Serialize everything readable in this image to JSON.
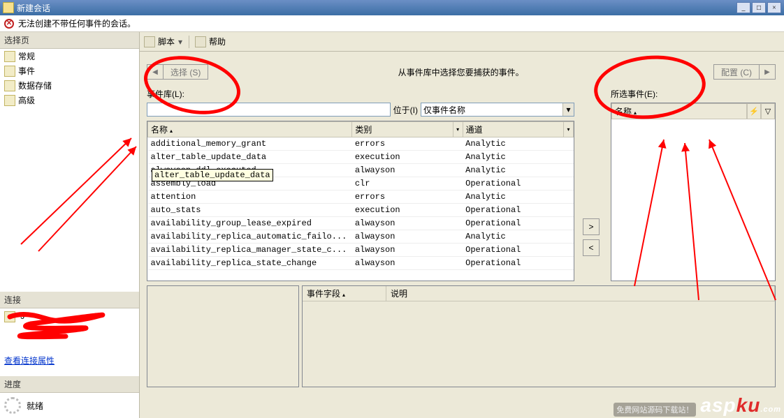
{
  "title": "新建会话",
  "window_buttons": {
    "min": "_",
    "max": "□",
    "close": "×"
  },
  "error": "无法创建不带任何事件的会话。",
  "sidebar": {
    "header_select": "选择页",
    "items": [
      {
        "label": "常规"
      },
      {
        "label": "事件"
      },
      {
        "label": "数据存储"
      },
      {
        "label": "高级"
      }
    ],
    "header_conn": "连接",
    "conn_value": "J",
    "view_conn": "查看连接属性",
    "header_progress": "进度",
    "progress_status": "就绪"
  },
  "toolbar": {
    "script": "脚本",
    "help": "帮助"
  },
  "main": {
    "select_btn": "选择 (S)",
    "center_label": "从事件库中选择您要捕获的事件。",
    "config_btn": "配置 (C)",
    "lib_label": "事件库(L):",
    "at_label": "位于(I)",
    "filter_combo": "仅事件名称",
    "selected_label": "所选事件(E):",
    "sel_col": "名称",
    "grid": {
      "cols": [
        "名称",
        "类别",
        "通道"
      ],
      "rows": [
        [
          "additional_memory_grant",
          "errors",
          "Analytic"
        ],
        [
          "alter_table_update_data",
          "execution",
          "Analytic"
        ],
        [
          "alwayson_ddl_executed",
          "alwayson",
          "Analytic"
        ],
        [
          "assembly_load",
          "clr",
          "Operational"
        ],
        [
          "attention",
          "errors",
          "Analytic"
        ],
        [
          "auto_stats",
          "execution",
          "Operational"
        ],
        [
          "availability_group_lease_expired",
          "alwayson",
          "Operational"
        ],
        [
          "availability_replica_automatic_failo...",
          "alwayson",
          "Analytic"
        ],
        [
          "availability_replica_manager_state_c...",
          "alwayson",
          "Operational"
        ],
        [
          "availability_replica_state_change",
          "alwayson",
          "Operational"
        ]
      ]
    },
    "tooltip": "alter_table_update_data",
    "move_right": ">",
    "move_left": "<",
    "bottom": {
      "field_col": "事件字段",
      "desc_col": "说明"
    }
  },
  "logo": {
    "asp": "asp",
    "ku": "ku",
    "dot": ".com",
    "tag": "免费网站源码下载站！"
  }
}
